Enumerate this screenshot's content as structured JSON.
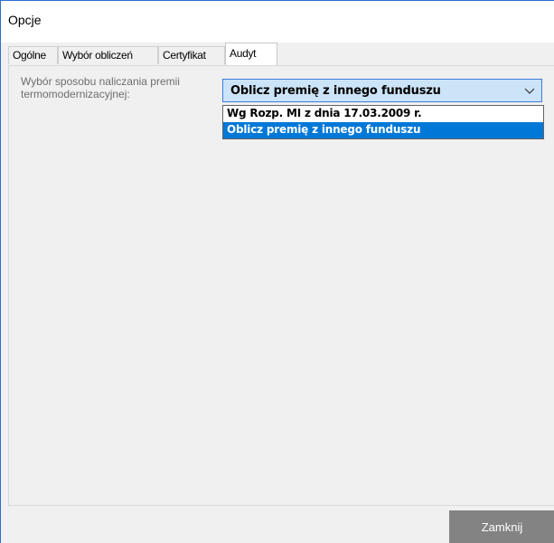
{
  "window": {
    "title": "Opcje"
  },
  "tabs": [
    {
      "label": "Ogólne",
      "active": false
    },
    {
      "label": "Wybór obliczeń",
      "active": false
    },
    {
      "label": "Certyfikat",
      "active": false
    },
    {
      "label": "Audyt",
      "active": true
    }
  ],
  "audyt": {
    "premium_label_line1": "Wybór sposobu naliczania premii",
    "premium_label_line2": "termomodernizacyjnej:",
    "premium_select": {
      "value": "Oblicz premię z innego funduszu",
      "options": [
        {
          "label": "Wg Rozp. MI z dnia 17.03.2009 r.",
          "selected": false
        },
        {
          "label": "Oblicz premię z innego funduszu",
          "selected": true
        }
      ],
      "expanded": true
    }
  },
  "footer": {
    "close_label": "Zamknij"
  },
  "colors": {
    "accent": "#0078d7",
    "combo_background": "#cce4f7",
    "button_background": "#838383"
  },
  "icons": {
    "dropdown_arrow": "chevron-down-icon"
  }
}
